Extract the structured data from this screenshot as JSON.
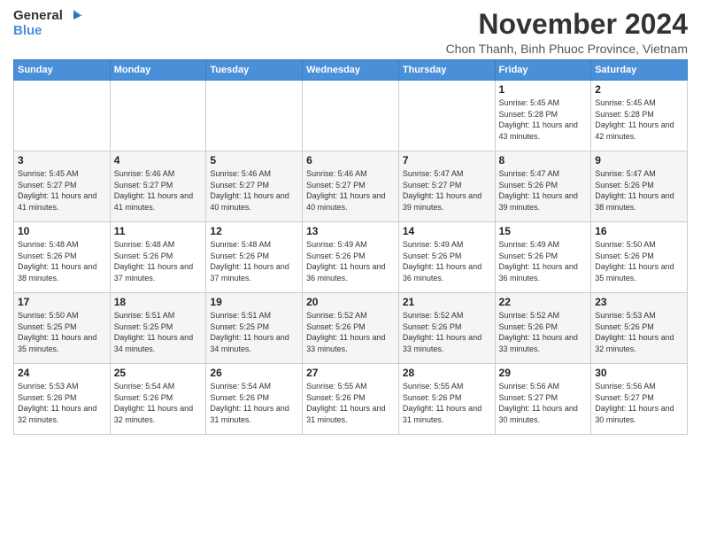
{
  "logo": {
    "line1": "General",
    "line2": "Blue"
  },
  "title": "November 2024",
  "subtitle": "Chon Thanh, Binh Phuoc Province, Vietnam",
  "days_header": [
    "Sunday",
    "Monday",
    "Tuesday",
    "Wednesday",
    "Thursday",
    "Friday",
    "Saturday"
  ],
  "weeks": [
    [
      {
        "day": "",
        "info": ""
      },
      {
        "day": "",
        "info": ""
      },
      {
        "day": "",
        "info": ""
      },
      {
        "day": "",
        "info": ""
      },
      {
        "day": "",
        "info": ""
      },
      {
        "day": "1",
        "info": "Sunrise: 5:45 AM\nSunset: 5:28 PM\nDaylight: 11 hours and 43 minutes."
      },
      {
        "day": "2",
        "info": "Sunrise: 5:45 AM\nSunset: 5:28 PM\nDaylight: 11 hours and 42 minutes."
      }
    ],
    [
      {
        "day": "3",
        "info": "Sunrise: 5:45 AM\nSunset: 5:27 PM\nDaylight: 11 hours and 41 minutes."
      },
      {
        "day": "4",
        "info": "Sunrise: 5:46 AM\nSunset: 5:27 PM\nDaylight: 11 hours and 41 minutes."
      },
      {
        "day": "5",
        "info": "Sunrise: 5:46 AM\nSunset: 5:27 PM\nDaylight: 11 hours and 40 minutes."
      },
      {
        "day": "6",
        "info": "Sunrise: 5:46 AM\nSunset: 5:27 PM\nDaylight: 11 hours and 40 minutes."
      },
      {
        "day": "7",
        "info": "Sunrise: 5:47 AM\nSunset: 5:27 PM\nDaylight: 11 hours and 39 minutes."
      },
      {
        "day": "8",
        "info": "Sunrise: 5:47 AM\nSunset: 5:26 PM\nDaylight: 11 hours and 39 minutes."
      },
      {
        "day": "9",
        "info": "Sunrise: 5:47 AM\nSunset: 5:26 PM\nDaylight: 11 hours and 38 minutes."
      }
    ],
    [
      {
        "day": "10",
        "info": "Sunrise: 5:48 AM\nSunset: 5:26 PM\nDaylight: 11 hours and 38 minutes."
      },
      {
        "day": "11",
        "info": "Sunrise: 5:48 AM\nSunset: 5:26 PM\nDaylight: 11 hours and 37 minutes."
      },
      {
        "day": "12",
        "info": "Sunrise: 5:48 AM\nSunset: 5:26 PM\nDaylight: 11 hours and 37 minutes."
      },
      {
        "day": "13",
        "info": "Sunrise: 5:49 AM\nSunset: 5:26 PM\nDaylight: 11 hours and 36 minutes."
      },
      {
        "day": "14",
        "info": "Sunrise: 5:49 AM\nSunset: 5:26 PM\nDaylight: 11 hours and 36 minutes."
      },
      {
        "day": "15",
        "info": "Sunrise: 5:49 AM\nSunset: 5:26 PM\nDaylight: 11 hours and 36 minutes."
      },
      {
        "day": "16",
        "info": "Sunrise: 5:50 AM\nSunset: 5:26 PM\nDaylight: 11 hours and 35 minutes."
      }
    ],
    [
      {
        "day": "17",
        "info": "Sunrise: 5:50 AM\nSunset: 5:25 PM\nDaylight: 11 hours and 35 minutes."
      },
      {
        "day": "18",
        "info": "Sunrise: 5:51 AM\nSunset: 5:25 PM\nDaylight: 11 hours and 34 minutes."
      },
      {
        "day": "19",
        "info": "Sunrise: 5:51 AM\nSunset: 5:25 PM\nDaylight: 11 hours and 34 minutes."
      },
      {
        "day": "20",
        "info": "Sunrise: 5:52 AM\nSunset: 5:26 PM\nDaylight: 11 hours and 33 minutes."
      },
      {
        "day": "21",
        "info": "Sunrise: 5:52 AM\nSunset: 5:26 PM\nDaylight: 11 hours and 33 minutes."
      },
      {
        "day": "22",
        "info": "Sunrise: 5:52 AM\nSunset: 5:26 PM\nDaylight: 11 hours and 33 minutes."
      },
      {
        "day": "23",
        "info": "Sunrise: 5:53 AM\nSunset: 5:26 PM\nDaylight: 11 hours and 32 minutes."
      }
    ],
    [
      {
        "day": "24",
        "info": "Sunrise: 5:53 AM\nSunset: 5:26 PM\nDaylight: 11 hours and 32 minutes."
      },
      {
        "day": "25",
        "info": "Sunrise: 5:54 AM\nSunset: 5:26 PM\nDaylight: 11 hours and 32 minutes."
      },
      {
        "day": "26",
        "info": "Sunrise: 5:54 AM\nSunset: 5:26 PM\nDaylight: 11 hours and 31 minutes."
      },
      {
        "day": "27",
        "info": "Sunrise: 5:55 AM\nSunset: 5:26 PM\nDaylight: 11 hours and 31 minutes."
      },
      {
        "day": "28",
        "info": "Sunrise: 5:55 AM\nSunset: 5:26 PM\nDaylight: 11 hours and 31 minutes."
      },
      {
        "day": "29",
        "info": "Sunrise: 5:56 AM\nSunset: 5:27 PM\nDaylight: 11 hours and 30 minutes."
      },
      {
        "day": "30",
        "info": "Sunrise: 5:56 AM\nSunset: 5:27 PM\nDaylight: 11 hours and 30 minutes."
      }
    ]
  ]
}
